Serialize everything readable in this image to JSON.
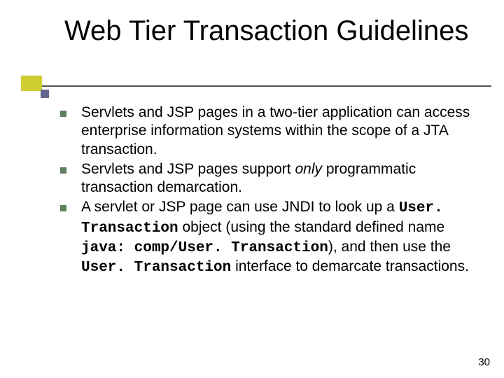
{
  "title": "Web Tier Transaction Guidelines",
  "bullets": {
    "b1": "Servlets and JSP pages in a two-tier application can access enterprise information systems within the scope of a JTA transaction.",
    "b2_pre": "Servlets and JSP pages support ",
    "b2_only": "only",
    "b2_post": " programmatic transaction demarcation.",
    "b3_a": "A servlet or JSP page can use JNDI to look up a ",
    "b3_code1": "User. Transaction",
    "b3_b": " object (using the standard defined name ",
    "b3_code2": "java: comp/User. Transaction",
    "b3_c": "), and then use the ",
    "b3_code3": "User. Transaction",
    "b3_d": " interface to demarcate transactions."
  },
  "page_number": "30"
}
